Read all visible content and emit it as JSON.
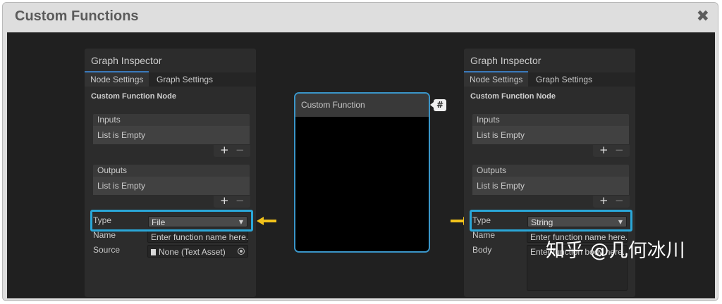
{
  "window": {
    "title": "Custom Functions",
    "close_icon": "close-icon"
  },
  "colors": {
    "highlight": "#2aa7d8",
    "arrow": "#f2c21b",
    "node_border": "#3a95c8"
  },
  "left_inspector": {
    "title": "Graph Inspector",
    "tabs": [
      "Node Settings",
      "Graph Settings"
    ],
    "node_heading": "Custom Function Node",
    "inputs": {
      "header": "Inputs",
      "empty": "List is Empty",
      "add": "+",
      "remove": "−"
    },
    "outputs": {
      "header": "Outputs",
      "empty": "List is Empty",
      "add": "+",
      "remove": "−"
    },
    "type": {
      "label": "Type",
      "value": "File"
    },
    "name": {
      "label": "Name",
      "placeholder": "Enter function name here..."
    },
    "source": {
      "label": "Source",
      "value": "None (Text Asset)"
    }
  },
  "node": {
    "title": "Custom Function",
    "badge": "#"
  },
  "right_inspector": {
    "title": "Graph Inspector",
    "tabs": [
      "Node Settings",
      "Graph Settings"
    ],
    "node_heading": "Custom Function Node",
    "inputs": {
      "header": "Inputs",
      "empty": "List is Empty",
      "add": "+",
      "remove": "−"
    },
    "outputs": {
      "header": "Outputs",
      "empty": "List is Empty",
      "add": "+",
      "remove": "−"
    },
    "type": {
      "label": "Type",
      "value": "String"
    },
    "name": {
      "label": "Name",
      "placeholder": "Enter function name here..."
    },
    "body": {
      "label": "Body",
      "placeholder": "Enter function body here..."
    }
  },
  "watermark": "知乎 @几何冰川"
}
